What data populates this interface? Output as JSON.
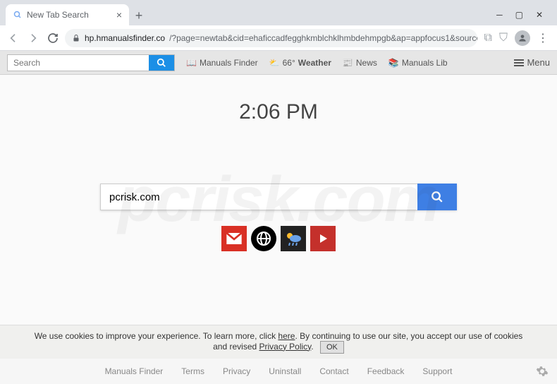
{
  "browser": {
    "tab_title": "New Tab Search",
    "url_host": "hp.hmanualsfinder.co",
    "url_path": "/?page=newtab&cid=ehaficcadfegghkmblchklhmbdehmpgb&ap=appfocus1&source=-lp0-t…"
  },
  "toolbar": {
    "search_placeholder": "Search",
    "manuals_finder": "Manuals Finder",
    "temp": "66°",
    "weather": "Weather",
    "news": "News",
    "manuals_lib": "Manuals Lib",
    "menu": "Menu"
  },
  "page": {
    "time": "2:06 PM",
    "search_value": "pcrisk.com"
  },
  "cookies": {
    "t1": "We use cookies to improve your experience. To learn more, click ",
    "here": "here",
    "t2": ". By continuing to use our site, you accept our use of cookies and revised ",
    "policy": "Privacy Policy",
    "ok": "OK"
  },
  "footer": {
    "links": [
      "Manuals Finder",
      "Terms",
      "Privacy",
      "Uninstall",
      "Contact",
      "Feedback",
      "Support"
    ]
  }
}
